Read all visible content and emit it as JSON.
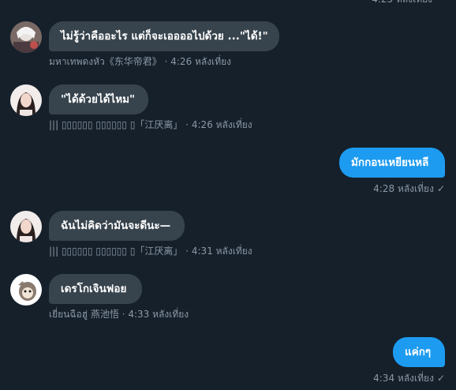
{
  "messages": [
    {
      "id": "m1",
      "direction": "in",
      "text": "ไม่รู้ว่าคืออะไร แต่ก็จะเออออไปด้วย ...\"ได้!\"",
      "sender": "มหาเทพดงหัว《东华帝君》",
      "time": "4:26 หลังเที่ยง",
      "avatar_icon": "avatar-white-hair-man-icon"
    },
    {
      "id": "m2",
      "direction": "in",
      "text": "\"ได้ด้วยได้ไหม\"",
      "sender": "||| ▯▯▯▯▯▯ ▯▯▯▯▯▯ ▯「江厌离」",
      "time": "4:26 หลังเที่ยง",
      "avatar_icon": "avatar-woman-icon"
    },
    {
      "id": "m3",
      "direction": "out",
      "text": "มักกอนเหยียนหลี",
      "time": "4:28 หลังเที่ยง"
    },
    {
      "id": "m4",
      "direction": "in",
      "text": "ฉันไม่คิดว่ามันจะดีนะ—",
      "sender": "||| ▯▯▯▯▯▯ ▯▯▯▯▯▯ ▯「江厌离」",
      "time": "4:31 หลังเที่ยง",
      "avatar_icon": "avatar-woman-icon"
    },
    {
      "id": "m5",
      "direction": "in",
      "text": "เดรโกเจินฟอย",
      "sender": "เยี่ยนฉือฮู่ 燕池悟",
      "time": "4:33 หลังเที่ยง",
      "avatar_icon": "avatar-cartoon-icon"
    },
    {
      "id": "m6",
      "direction": "out",
      "text": "แค่กๆ",
      "time": "4:34 หลังเที่ยง"
    }
  ],
  "top_clip": "4:25 หลังเที่ยง",
  "separator": " · ",
  "read_check": "✓"
}
